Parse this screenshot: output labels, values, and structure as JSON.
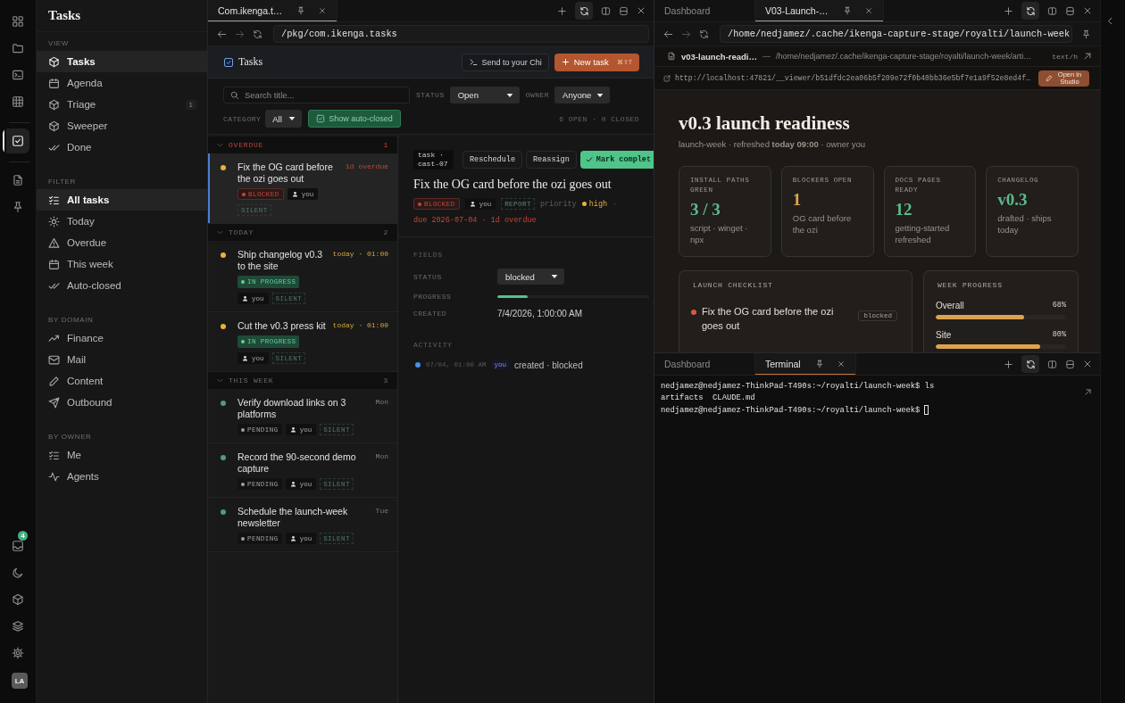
{
  "rail": {
    "groups": [
      [
        {
          "kind": "grid",
          "selected": false
        },
        {
          "kind": "folder",
          "selected": false
        },
        {
          "kind": "terminal",
          "selected": false
        },
        {
          "kind": "table",
          "selected": false
        }
      ],
      [
        {
          "kind": "check",
          "selected": true
        }
      ],
      [
        {
          "kind": "file",
          "selected": false
        },
        {
          "kind": "pin",
          "selected": false
        }
      ]
    ],
    "bottom": [
      {
        "kind": "inbox",
        "badge": "4"
      },
      {
        "kind": "moon"
      },
      {
        "kind": "cube"
      },
      {
        "kind": "layers"
      },
      {
        "kind": "gear"
      }
    ],
    "avatar": "LA"
  },
  "sidebar": {
    "title": "Tasks",
    "sections": [
      {
        "heading": "VIEW",
        "items": [
          {
            "label": "Tasks",
            "kind": "cube",
            "selected": true
          },
          {
            "label": "Agenda",
            "kind": "calendar",
            "selected": false
          },
          {
            "label": "Triage",
            "kind": "cube",
            "selected": false,
            "count": "1"
          },
          {
            "label": "Sweeper",
            "kind": "cube",
            "selected": false
          },
          {
            "label": "Done",
            "kind": "checks",
            "selected": false
          }
        ]
      },
      {
        "heading": "FILTER",
        "items": [
          {
            "label": "All tasks",
            "kind": "list",
            "selected": true
          },
          {
            "label": "Today",
            "kind": "sun",
            "selected": false
          },
          {
            "label": "Overdue",
            "kind": "warning",
            "selected": false
          },
          {
            "label": "This week",
            "kind": "calendar",
            "selected": false
          },
          {
            "label": "Auto-closed",
            "kind": "checks",
            "selected": false
          }
        ]
      },
      {
        "heading": "BY DOMAIN",
        "items": [
          {
            "label": "Finance",
            "kind": "trend",
            "selected": false
          },
          {
            "label": "Mail",
            "kind": "mail",
            "selected": false
          },
          {
            "label": "Content",
            "kind": "pencil",
            "selected": false
          },
          {
            "label": "Outbound",
            "kind": "send",
            "selected": false
          }
        ]
      },
      {
        "heading": "BY OWNER",
        "items": [
          {
            "label": "Me",
            "kind": "list",
            "selected": false
          },
          {
            "label": "Agents",
            "kind": "pulse",
            "selected": false
          }
        ]
      }
    ]
  },
  "tasks_pane": {
    "tabs": [
      {
        "label": "Com.ikenga.t…",
        "selected": true
      }
    ],
    "address": "/pkg/com.ikenga.tasks",
    "title": "Tasks",
    "send_button": "Send to your Chi",
    "new_button": "New task",
    "shortcut": "⌘⇧T",
    "search": {
      "placeholder": "Search title..."
    },
    "status_label": "STATUS",
    "status": "Open",
    "owner_label": "OWNER",
    "owner": "Anyone",
    "category_label": "CATEGORY",
    "category": "All",
    "auto_closed": {
      "label": "Show auto-closed",
      "on": true
    },
    "summary": "6 OPEN · 0 CLOSED",
    "groups": [
      {
        "title": "OVERDUE",
        "count": "1",
        "kind": "overdue",
        "expanded": true,
        "tasks": [
          {
            "title": "Fix the OG card before the ozi goes out",
            "due": "1d overdue",
            "color": "#e8b339",
            "status": {
              "label": "BLOCKED",
              "kind": "blocked"
            },
            "owner": "you",
            "tag": "SILENT",
            "selected": true
          }
        ]
      },
      {
        "title": "TODAY",
        "count": "2",
        "kind": "today",
        "expanded": true,
        "tasks": [
          {
            "title": "Ship changelog v0.3 to the site",
            "due": "today · 01:00",
            "color": "#e8b339",
            "status": {
              "label": "IN PROGRESS",
              "kind": "progress"
            },
            "owner": "you",
            "tag": "SILENT",
            "selected": false
          },
          {
            "title": "Cut the v0.3 press kit",
            "due": "today · 01:00",
            "color": "#e8b339",
            "status": {
              "label": "IN PROGRESS",
              "kind": "progress"
            },
            "owner": "you",
            "tag": "SILENT",
            "selected": false
          }
        ]
      },
      {
        "title": "THIS WEEK",
        "count": "3",
        "kind": "week",
        "expanded": true,
        "tasks": [
          {
            "title": "Verify download links on 3 platforms",
            "due": "Mon",
            "color": "#4f9a80",
            "status": {
              "label": "PENDING",
              "kind": "pending"
            },
            "owner": "you",
            "tag": "SILENT",
            "selected": false
          },
          {
            "title": "Record the 90-second demo capture",
            "due": "Mon",
            "color": "#4f9a80",
            "status": {
              "label": "PENDING",
              "kind": "pending"
            },
            "owner": "you",
            "tag": "SILENT",
            "selected": false
          },
          {
            "title": "Schedule the launch-week newsletter",
            "due": "Tue",
            "color": "#4f9a80",
            "status": {
              "label": "PENDING",
              "kind": "pending"
            },
            "owner": "you",
            "tag": "SILENT",
            "selected": false
          }
        ]
      }
    ],
    "detail": {
      "id": "task · cast-07",
      "actions": [
        "Reschedule",
        "Reassign"
      ],
      "complete_button": "Mark complet",
      "title": "Fix the OG card before the ozi goes out",
      "status": {
        "label": "BLOCKED",
        "kind": "blocked"
      },
      "owner": "you",
      "tag": "REPORT",
      "priority_label": "priority",
      "priority": "high",
      "separator": "·",
      "due": "due 2026-07-04 · 1d overdue",
      "fields_heading": "FIELDS",
      "fields": [
        {
          "label": "STATUS",
          "kind": "select",
          "value": "blocked"
        },
        {
          "label": "PROGRESS",
          "kind": "progress",
          "level": 0.2
        },
        {
          "label": "CREATED",
          "kind": "text",
          "value": "7/4/2026, 1:00:00 AM"
        }
      ],
      "activity_heading": "ACTIVITY",
      "activity": [
        {
          "time": "07/04, 01:00 AM",
          "actor": "you",
          "text": "created · blocked",
          "color": "#4a8ef0"
        }
      ]
    }
  },
  "viewer_pane": {
    "tabs": [
      {
        "label": "Dashboard",
        "selected": false
      },
      {
        "label": "V03-Launch-…",
        "selected": true
      }
    ],
    "address": "/home/nedjamez/.cache/ikenga-capture-stage/royalti/launch-week",
    "file": {
      "name": "v03-launch-readi…",
      "dash": "—",
      "path": "/home/nedjamez/.cache/ikenga-capture-stage/royalti/launch-week/arti…",
      "type": "text/h"
    },
    "url": "http://localhost:47821/__viewer/b51dfdc2ea06b5f209e72f0b40bb36e5bf7e1a9f52e8ed4f…",
    "studio_button": "Open in Studio",
    "doc": {
      "title": "v0.3 launch readiness",
      "subtitle": "launch-week · refreshed **today 09:00** · owner you",
      "stats": [
        {
          "label": "INSTALL PATHS GREEN",
          "value": "3 / 3",
          "note": "script · winget · npx",
          "kind": "good"
        },
        {
          "label": "BLOCKERS OPEN",
          "value": "1",
          "note": "OG card before the ozi",
          "kind": "warn"
        },
        {
          "label": "DOCS PAGES READY",
          "value": "12",
          "note": "getting-started refreshed",
          "kind": "good"
        },
        {
          "label": "CHANGELOG",
          "value": "v0.3",
          "note": "drafted · ships today",
          "kind": "good"
        }
      ],
      "checklist": {
        "heading": "LAUNCH CHECKLIST",
        "items": [
          {
            "text": "Fix the OG card before the ozi goes out",
            "status": "blocked",
            "color": "#d9574a"
          }
        ]
      },
      "progress": {
        "heading": "WEEK PROGRESS",
        "rows": [
          {
            "label": "Overall",
            "value": "68%",
            "level": 0.68
          },
          {
            "label": "Site",
            "value": "80%",
            "level": 0.8
          }
        ]
      }
    }
  },
  "terminal_pane": {
    "tabs": [
      {
        "label": "Dashboard",
        "selected": false
      },
      {
        "label": "Terminal",
        "selected": true
      }
    ],
    "lines": [
      "nedjamez@nedjamez-ThinkPad-T490s:~/royalti/launch-week$ ls",
      "artifacts  CLAUDE.md",
      "nedjamez@nedjamez-ThinkPad-T490s:~/royalti/launch-week$"
    ],
    "cursor": true
  }
}
